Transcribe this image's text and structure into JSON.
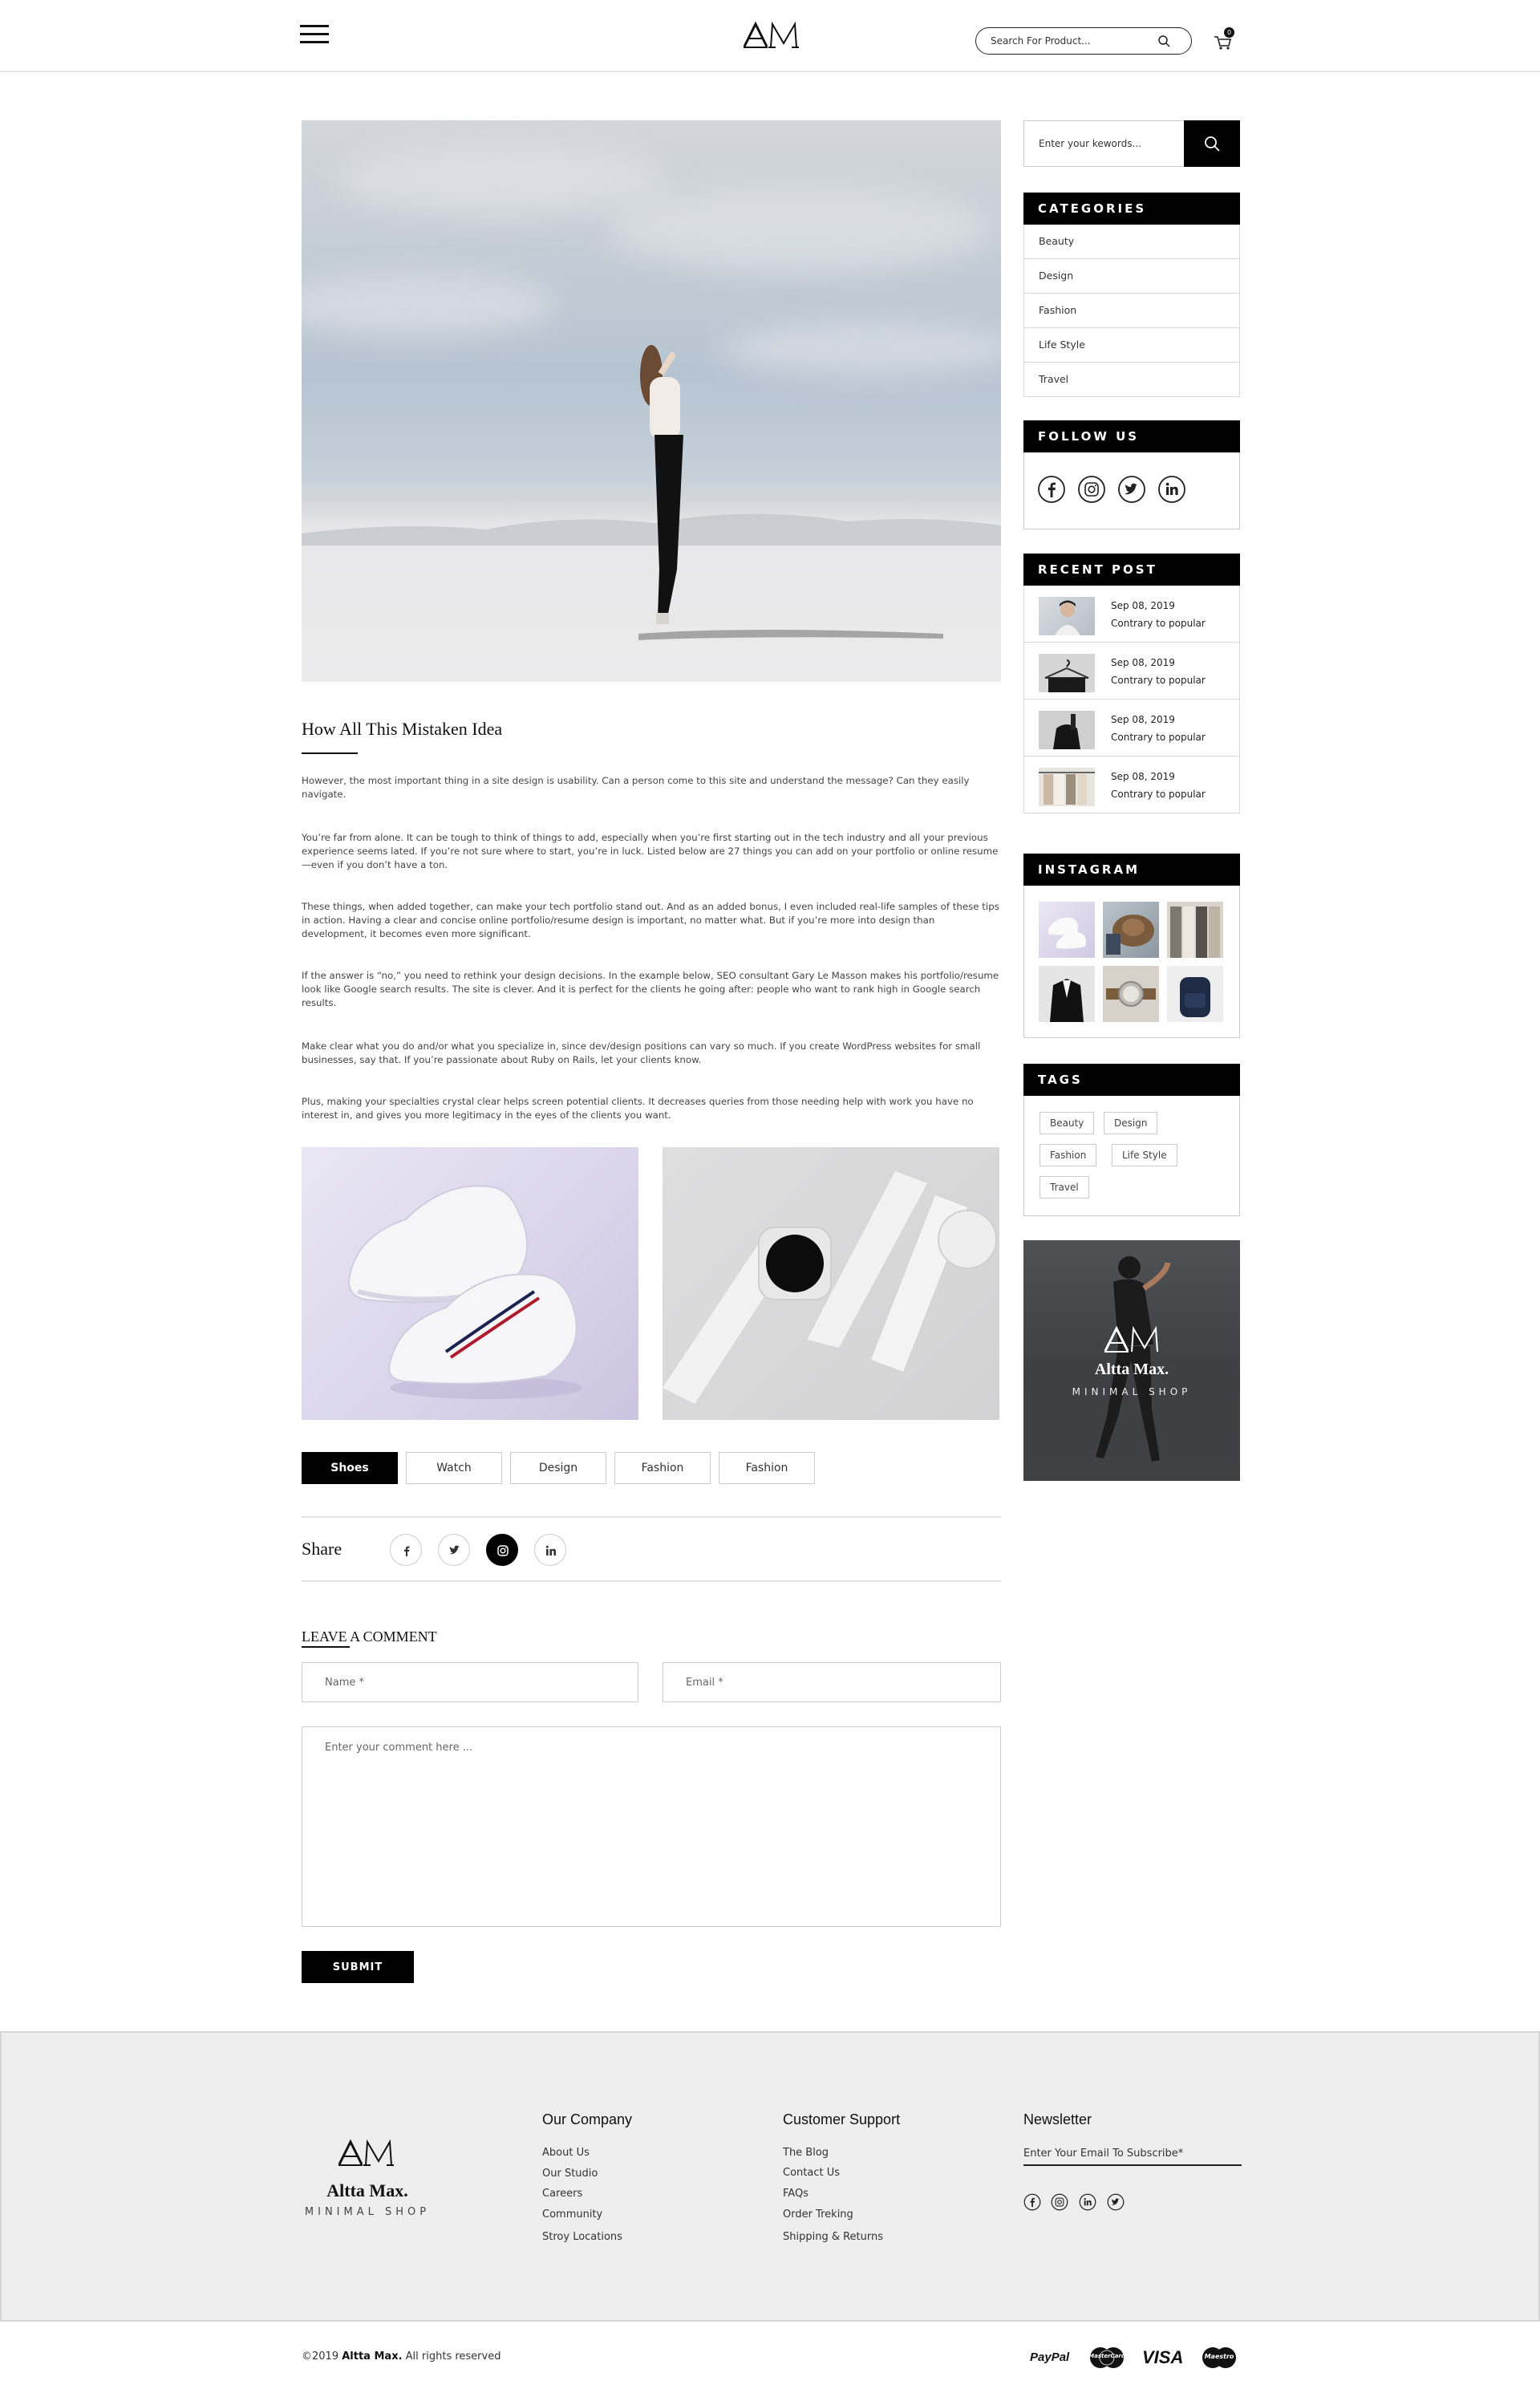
{
  "header": {
    "search_placeholder": "Search For Product...",
    "cart_count": "0"
  },
  "article": {
    "title": "How All This Mistaken Idea",
    "paragraphs": [
      "However, the most important thing in a site design is usability. Can a person come to this site and understand the message? Can they easily navigate.",
      "You’re far from alone. It can be tough to think of things to add, especially when you’re first starting out in the tech industry and all your previous experience seems lated. If you’re not sure where to start, you’re in luck. Listed below are 27 things you can add on your portfolio or online resume—even if you don’t have a ton.",
      "These things, when added together, can make your tech portfolio stand out. And as an added bonus, I even included real-life samples of these tips in action. Having a clear and concise online portfolio/resume design is important, no matter what. But if you’re more into design than development, it becomes even more significant.",
      "If the answer is “no,” you need to rethink your design decisions. In the example below, SEO consultant Gary Le Masson makes his portfolio/resume look like Google search results. The site is clever. And it is perfect for the clients he going after: people who want to rank high in Google search results.",
      "Make clear what you do and/or what you specialize in, since dev/design positions can vary so much. If you create WordPress websites for small businesses, say that. If you’re passionate about Ruby on Rails, let your clients know.",
      "Plus, making your specialties crystal clear helps screen potential clients. It decreases queries from those needing help with work you have no interest in, and gives you more legitimacy in the eyes of the clients you want."
    ],
    "tags": [
      "Shoes",
      "Watch",
      "Design",
      "Fashion",
      "Fashion"
    ],
    "share_label": "Share"
  },
  "comment": {
    "heading": "LEAVE A COMMENT",
    "name_placeholder": "Name *",
    "email_placeholder": "Email *",
    "comment_placeholder": "Enter your comment here ...",
    "submit_label": "SUBMIT"
  },
  "sidebar": {
    "search_placeholder": "Enter your kewords...",
    "categories_title": "CATEGORIES",
    "categories": [
      "Beauty",
      "Design",
      "Fashion",
      "Life Style",
      "Travel"
    ],
    "follow_title": "FOLLOW US",
    "recent_title": "RECENT POST",
    "recent_posts": [
      {
        "date": "Sep 08, 2019",
        "title": "Contrary to popular"
      },
      {
        "date": "Sep 08, 2019",
        "title": "Contrary to popular"
      },
      {
        "date": "Sep 08, 2019",
        "title": "Contrary to popular"
      },
      {
        "date": "Sep 08, 2019",
        "title": "Contrary to popular"
      }
    ],
    "instagram_title": "INSTAGRAM",
    "tags_title": "TAGS",
    "tags": [
      "Beauty",
      "Design",
      "Fashion",
      "Life Style",
      "Travel"
    ],
    "banner_name": "Altta Max.",
    "banner_tagline": "MINIMAL SHOP"
  },
  "footer": {
    "brand": "Altta Max.",
    "tagline": "MINIMAL SHOP",
    "company_title": "Our Company",
    "company_links": [
      "About Us",
      "Our Studio",
      "Careers",
      "Community",
      "Stroy Locations"
    ],
    "support_title": "Customer Support",
    "support_links": [
      "The Blog",
      "Contact Us",
      "FAQs",
      "Order Treking",
      "Shipping & Returns"
    ],
    "newsletter_title": "Newsletter",
    "newsletter_placeholder": "Enter Your Email To Subscribe*",
    "copyright_prefix": "©2019",
    "copyright_brand": "Altta Max.",
    "copyright_suffix": "All rights reserved",
    "payments": [
      "PayPal",
      "MasterCard",
      "VISA",
      "Maestro"
    ]
  }
}
